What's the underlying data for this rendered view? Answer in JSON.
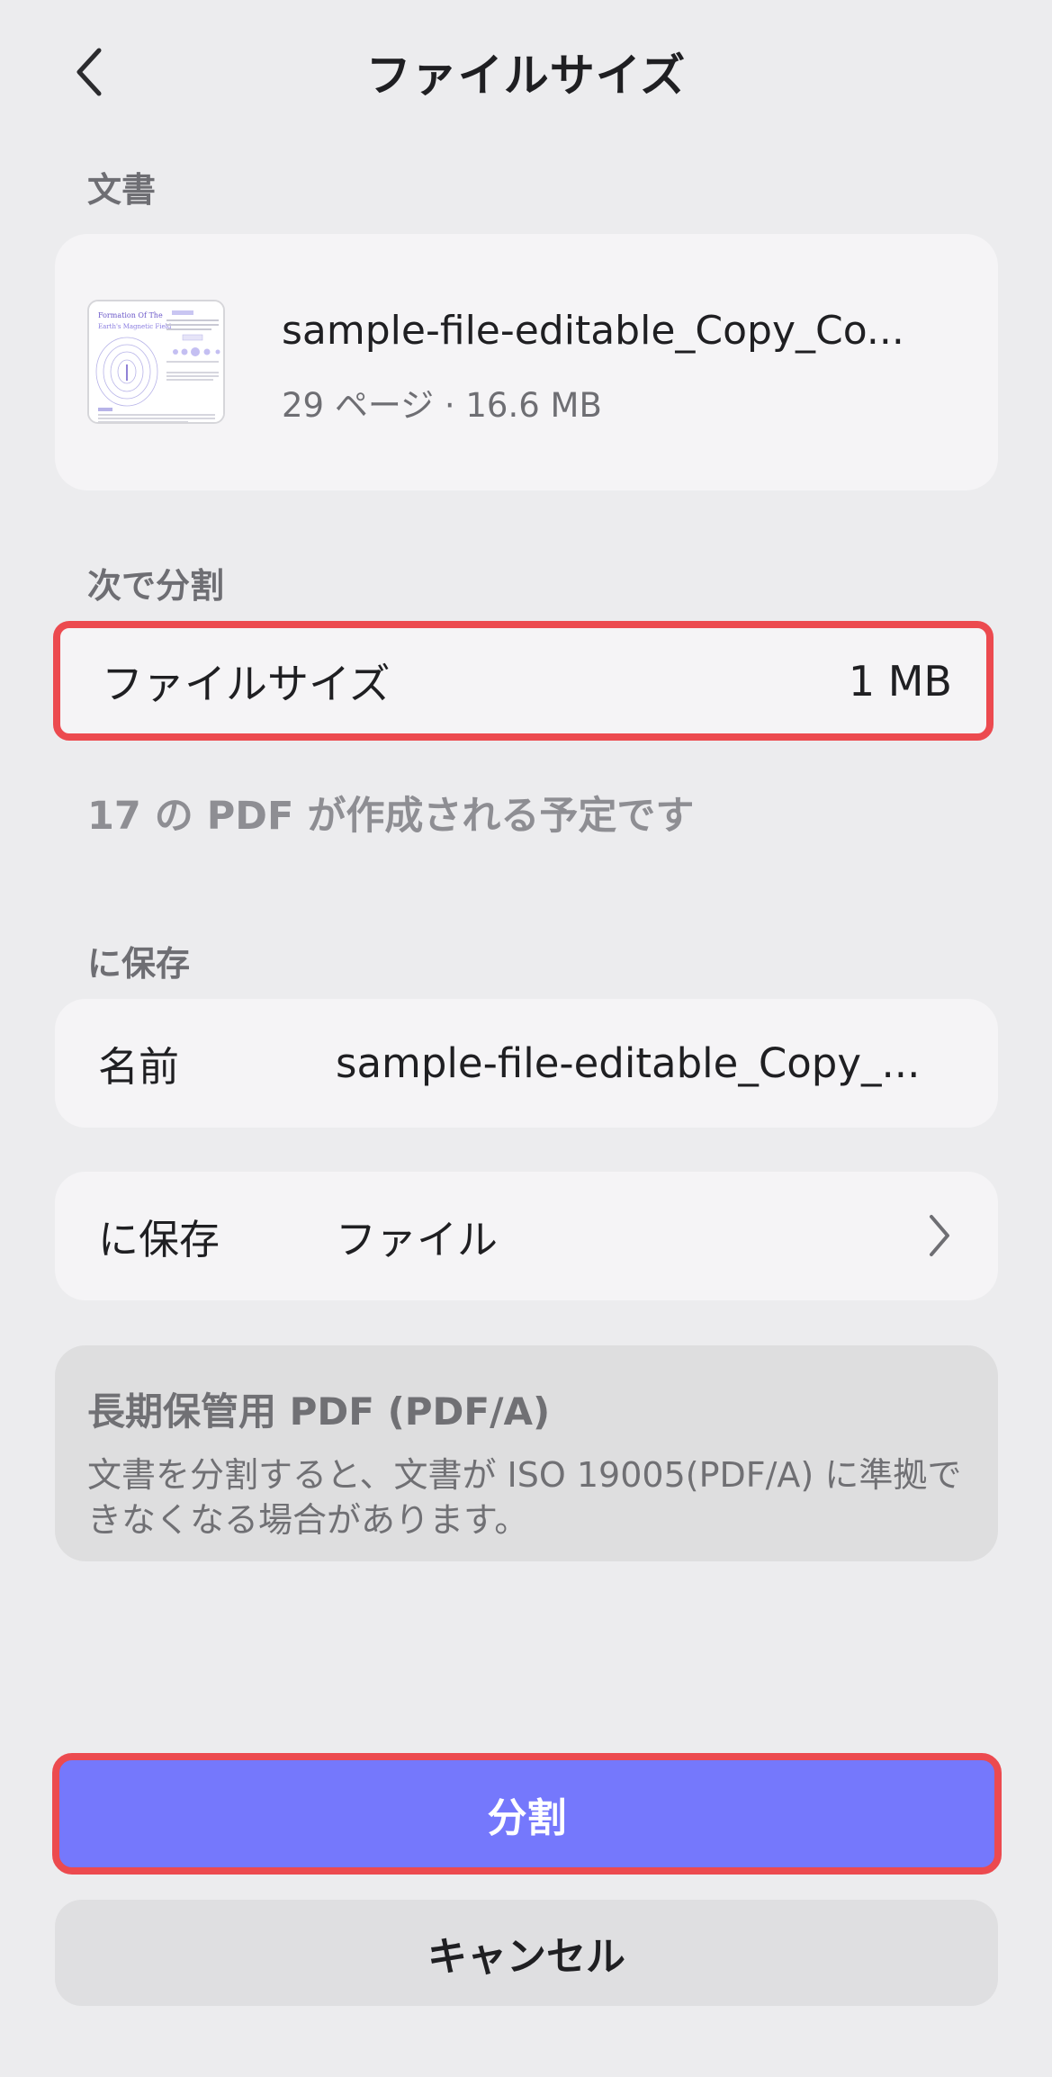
{
  "header": {
    "title": "ファイルサイズ",
    "back_icon": "chevron-left-icon"
  },
  "document_section": {
    "label": "文書",
    "file_name": "sample-file-editable_Copy_Co...",
    "meta": "29 ページ · 16.6 MB",
    "thumbnail": {
      "title_line1": "Formation Of The",
      "title_line2": "Earth's Magnetic Field",
      "accent_color": "#7578fc"
    }
  },
  "split_section": {
    "label": "次で分割",
    "option_label": "ファイルサイズ",
    "option_value": "1 MB",
    "result_note": "17 の PDF が作成される予定です"
  },
  "save_section": {
    "label": "に保存",
    "name_label": "名前",
    "name_value": "sample-file-editable_Copy_...",
    "location_label": "に保存",
    "location_value": "ファイル"
  },
  "pdfa": {
    "title": "長期保管用 PDF (PDF/A)",
    "text": "文書を分割すると、文書が ISO 19005(PDF/A) に準拠できなくなる場合があります。"
  },
  "buttons": {
    "split": "分割",
    "cancel": "キャンセル"
  },
  "colors": {
    "primary": "#7578fc",
    "highlight": "#ec4a4f",
    "background": "#ececee"
  }
}
